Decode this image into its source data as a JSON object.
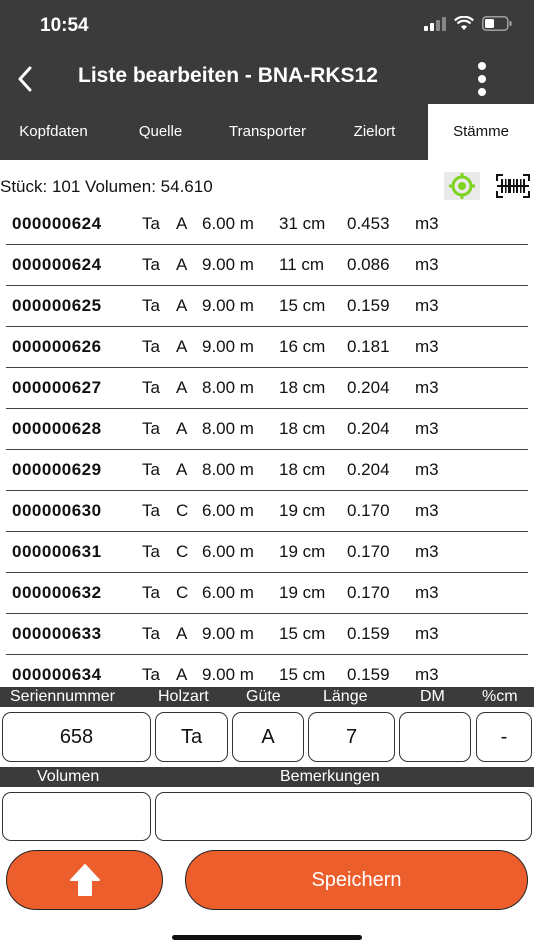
{
  "status_bar": {
    "time": "10:54"
  },
  "nav": {
    "title": "Liste bearbeiten - BNA-RKS12"
  },
  "tabs": [
    {
      "label": "Kopfdaten"
    },
    {
      "label": "Quelle"
    },
    {
      "label": "Transporter"
    },
    {
      "label": "Zielort"
    },
    {
      "label": "Stämme"
    }
  ],
  "summary": {
    "text": "Stück: 101 Volumen: 54.610"
  },
  "rows": [
    {
      "serial": "000000624",
      "art": "Ta",
      "q": "A",
      "len": "6.00 m",
      "dm": "31 cm",
      "vol": "0.453",
      "unit": "m3"
    },
    {
      "serial": "000000624",
      "art": "Ta",
      "q": "A",
      "len": "9.00 m",
      "dm": "11 cm",
      "vol": "0.086",
      "unit": "m3"
    },
    {
      "serial": "000000625",
      "art": "Ta",
      "q": "A",
      "len": "9.00 m",
      "dm": "15 cm",
      "vol": "0.159",
      "unit": "m3"
    },
    {
      "serial": "000000626",
      "art": "Ta",
      "q": "A",
      "len": "9.00 m",
      "dm": "16 cm",
      "vol": "0.181",
      "unit": "m3"
    },
    {
      "serial": "000000627",
      "art": "Ta",
      "q": "A",
      "len": "8.00 m",
      "dm": "18 cm",
      "vol": "0.204",
      "unit": "m3"
    },
    {
      "serial": "000000628",
      "art": "Ta",
      "q": "A",
      "len": "8.00 m",
      "dm": "18 cm",
      "vol": "0.204",
      "unit": "m3"
    },
    {
      "serial": "000000629",
      "art": "Ta",
      "q": "A",
      "len": "8.00 m",
      "dm": "18 cm",
      "vol": "0.204",
      "unit": "m3"
    },
    {
      "serial": "000000630",
      "art": "Ta",
      "q": "C",
      "len": "6.00 m",
      "dm": "19 cm",
      "vol": "0.170",
      "unit": "m3"
    },
    {
      "serial": "000000631",
      "art": "Ta",
      "q": "C",
      "len": "6.00 m",
      "dm": "19 cm",
      "vol": "0.170",
      "unit": "m3"
    },
    {
      "serial": "000000632",
      "art": "Ta",
      "q": "C",
      "len": "6.00 m",
      "dm": "19 cm",
      "vol": "0.170",
      "unit": "m3"
    },
    {
      "serial": "000000633",
      "art": "Ta",
      "q": "A",
      "len": "9.00 m",
      "dm": "15 cm",
      "vol": "0.159",
      "unit": "m3"
    },
    {
      "serial": "000000634",
      "art": "Ta",
      "q": "A",
      "len": "9.00 m",
      "dm": "15 cm",
      "vol": "0.159",
      "unit": "m3"
    }
  ],
  "form": {
    "labels": {
      "seriennummer": "Seriennummer",
      "holzart": "Holzart",
      "guete": "Güte",
      "laenge": "Länge",
      "dm": "DM",
      "pct_cm": "%cm",
      "volumen": "Volumen",
      "bemerkungen": "Bemerkungen"
    },
    "values": {
      "seriennummer": "658",
      "holzart": "Ta",
      "guete": "A",
      "laenge": "7",
      "dm": "",
      "pct_cm": "-",
      "volumen": "",
      "bemerkungen": ""
    }
  },
  "buttons": {
    "save_label": "Speichern"
  },
  "icons": {
    "back": "chevron-left-icon",
    "more": "more-vertical-icon",
    "gps": "gps-location-icon",
    "barcode": "barcode-scan-icon",
    "up": "arrow-up-icon"
  },
  "colors": {
    "header_bg": "#3b3b3b",
    "accent": "#ec5f2d",
    "gps_green": "#7ed321"
  }
}
